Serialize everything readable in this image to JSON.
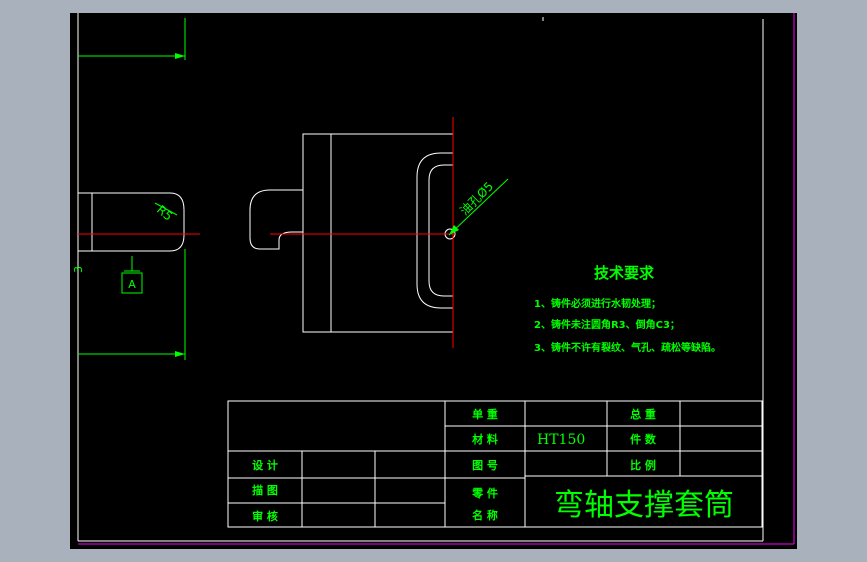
{
  "colors": {
    "background": "#000000",
    "frame": "#ffffff",
    "border": "#ff00ff",
    "geometry": "#ffffff",
    "dimension": "#00ff00",
    "centerline": "#ff0000",
    "text": "#00ff00"
  },
  "dimensions": {
    "radius_label": "R5",
    "hole_label": "油孔Ø5",
    "partial_label": "3",
    "datum_label": "A"
  },
  "technical_requirements": {
    "title": "技术要求",
    "items": [
      "1、铸件必须进行水韧处理；",
      "2、铸件未注圆角R3、倒角C3；",
      "3、铸件不许有裂纹、气孔、疏松等缺陷。"
    ]
  },
  "title_block": {
    "unit_weight_label": "单 重",
    "unit_weight_value": "",
    "total_weight_label": "总 重",
    "total_weight_value": "",
    "material_label": "材 料",
    "material_value": "HT150",
    "quantity_label": "件 数",
    "quantity_value": "",
    "drawing_no_label": "图 号",
    "drawing_no_value": "",
    "scale_label": "比 例",
    "scale_value": "",
    "design_label": "设 计",
    "drafting_label": "描 图",
    "review_label": "审 核",
    "part_name_label_1": "零 件",
    "part_name_label_2": "名 称",
    "part_name": "弯轴支撑套筒"
  }
}
